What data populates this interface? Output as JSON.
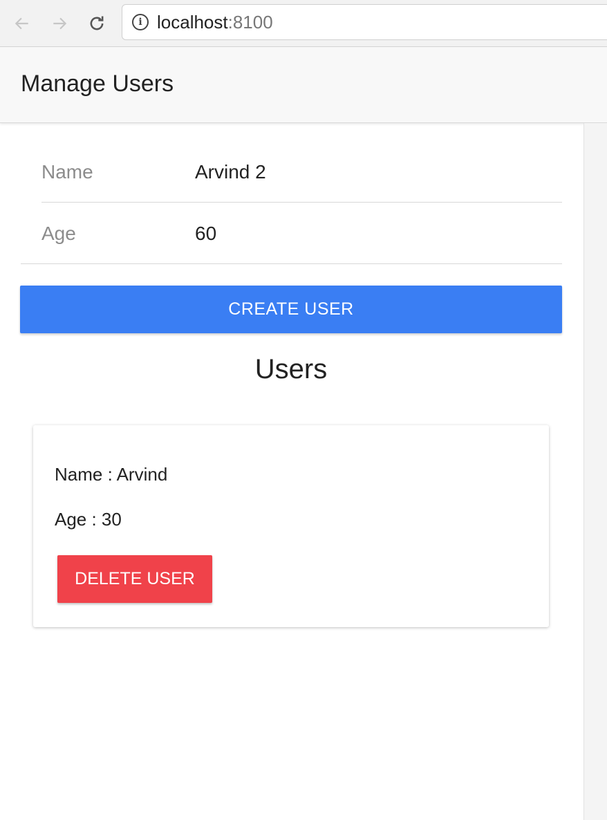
{
  "browser": {
    "url_host": "localhost",
    "url_port": ":8100",
    "icons": {
      "back": "back-arrow-icon",
      "forward": "forward-arrow-icon",
      "reload": "reload-icon",
      "info": "info-icon"
    }
  },
  "header": {
    "title": "Manage Users"
  },
  "form": {
    "name_label": "Name",
    "name_value": "Arvind 2",
    "age_label": "Age",
    "age_value": "60",
    "create_button": "CREATE USER"
  },
  "users_heading": "Users",
  "users": [
    {
      "name_line": "Name : Arvind",
      "age_line": "Age : 30",
      "delete_button": "DELETE USER"
    }
  ],
  "colors": {
    "primary": "#3a7ef3",
    "danger": "#f0424a"
  }
}
